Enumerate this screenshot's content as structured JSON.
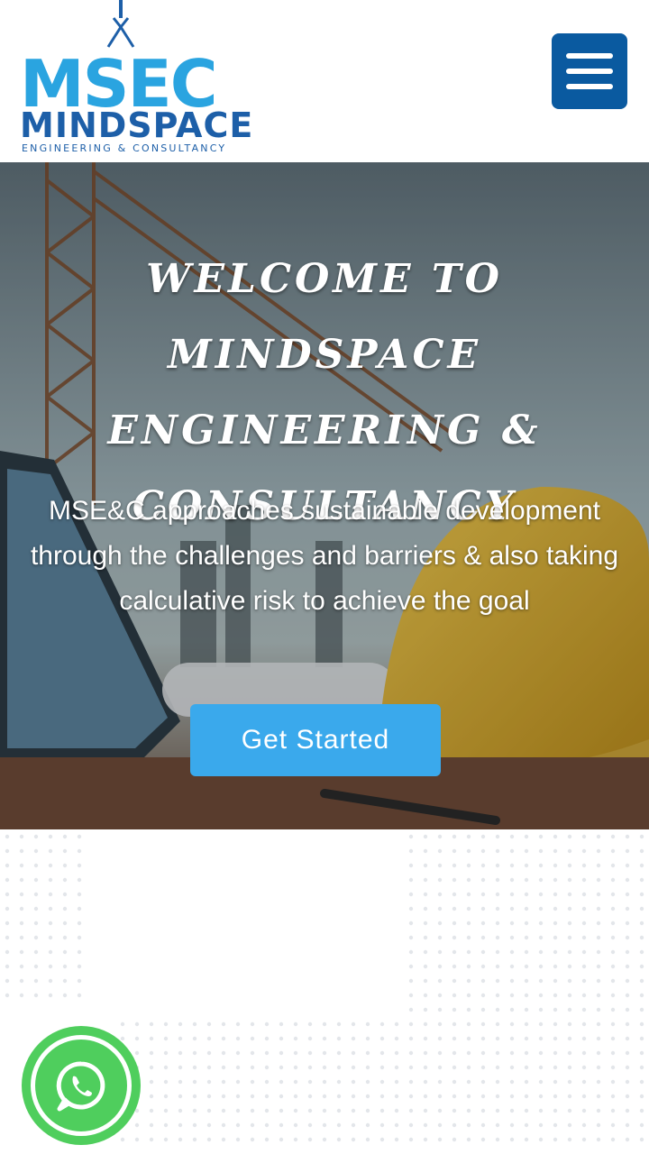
{
  "header": {
    "logo": {
      "mark_text": "MSEC",
      "name_text": "MINDSPACE",
      "tagline": "ENGINEERING & CONSULTANCY"
    },
    "menu_icon": "hamburger-menu-icon"
  },
  "hero": {
    "title": "Welcome to Mindspace Engineering & Consultancy",
    "description": "MSE&C approaches sustainable development through the challenges and barriers & also taking calculative risk to achieve the goal",
    "cta_label": "Get Started"
  },
  "floating": {
    "whatsapp_icon": "whatsapp-icon"
  },
  "colors": {
    "brand_blue": "#0a5aa0",
    "cta_blue": "#3aa9ec",
    "logo_cyan": "#2aa4e0",
    "whatsapp_green": "#4fce5d"
  }
}
